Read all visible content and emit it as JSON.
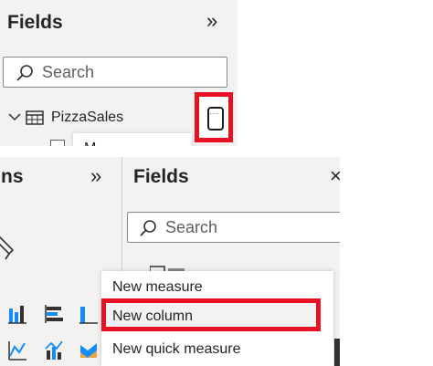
{
  "top": {
    "pane_title": "Fields",
    "collapse_glyph": "»",
    "search_placeholder": "Search",
    "table_name": "PizzaSales",
    "more_options_glyph": "···",
    "peek_text": "M"
  },
  "bottom": {
    "viz_pane_title_partial": "ns",
    "viz_collapse_glyph": "»",
    "fields_pane_title": "Fields",
    "close_glyph": "×",
    "search_placeholder": "Search",
    "context_menu": {
      "items": [
        "New measure",
        "New column",
        "New quick measure"
      ]
    }
  },
  "colors": {
    "highlight_red": "#e81123",
    "pane_bg": "#f3f2f1",
    "viz_blue": "#118dff"
  },
  "icons": {
    "search": "search-icon",
    "table": "table-icon",
    "expand": "chevron-down-icon",
    "more_options": "more-options-icon",
    "format": "format-brush-icon"
  }
}
